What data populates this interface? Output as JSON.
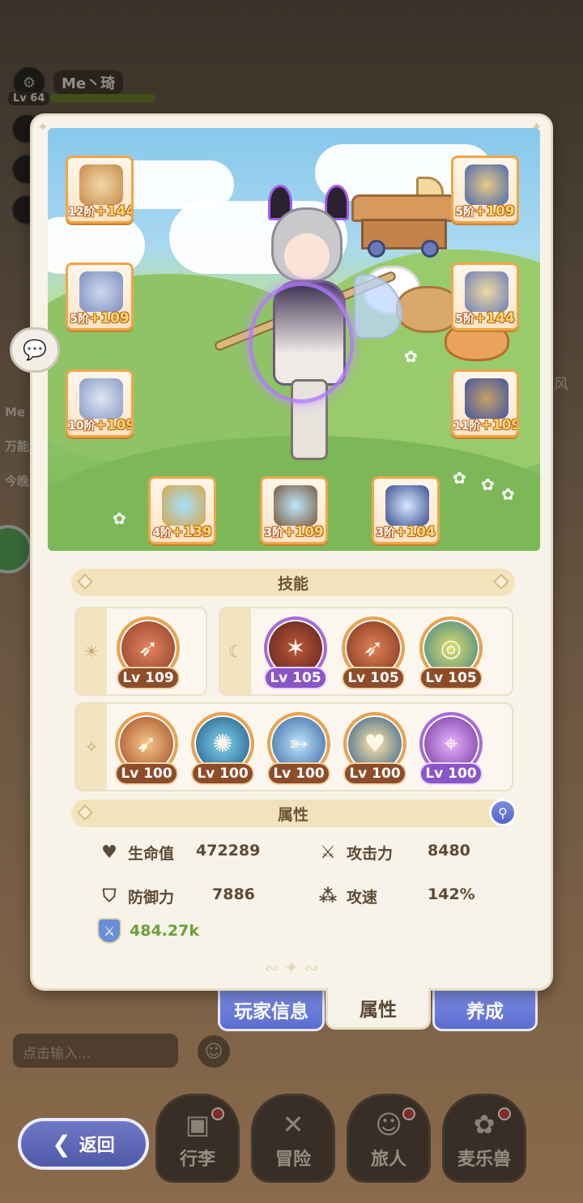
{
  "hud": {
    "player_name": "Me丶琦",
    "player_level": "Lv 64",
    "side_texts": [
      "Me",
      "万能",
      "今晚"
    ],
    "right_text": "风"
  },
  "chat": {
    "placeholder": "点击输入..."
  },
  "nav": {
    "items": [
      {
        "label": "行李",
        "icon": "luggage-icon",
        "badge": true
      },
      {
        "label": "冒险",
        "icon": "crossed-swords-icon",
        "badge": false
      },
      {
        "label": "旅人",
        "icon": "traveler-icon",
        "badge": true
      },
      {
        "label": "麦乐兽",
        "icon": "beast-icon",
        "badge": true
      }
    ],
    "back_label": "返回"
  },
  "equipment": {
    "left": [
      {
        "name": "bow",
        "tier": "12阶",
        "bonus": "+144"
      },
      {
        "name": "armor",
        "tier": "5阶",
        "bonus": "+109"
      },
      {
        "name": "greaves",
        "tier": "10阶",
        "bonus": "+109"
      }
    ],
    "right": [
      {
        "name": "helmet",
        "tier": "5阶",
        "bonus": "+109"
      },
      {
        "name": "gloves",
        "tier": "5阶",
        "bonus": "+144"
      },
      {
        "name": "boots",
        "tier": "11阶",
        "bonus": "+109"
      }
    ],
    "bottom": [
      {
        "name": "ring",
        "tier": "4阶",
        "bonus": "+139"
      },
      {
        "name": "necklace",
        "tier": "3阶",
        "bonus": "+109"
      },
      {
        "name": "amulet",
        "tier": "3阶",
        "bonus": "+104"
      }
    ]
  },
  "skills": {
    "header": "技能",
    "group1": {
      "icon": "sun-icon",
      "skills": [
        {
          "level": "Lv 109",
          "style": "orange"
        }
      ]
    },
    "group2": {
      "icon": "moon-icon",
      "skills": [
        {
          "level": "Lv 105",
          "style": "purple"
        },
        {
          "level": "Lv 105",
          "style": "orange"
        },
        {
          "level": "Lv 105",
          "style": "orange"
        }
      ]
    },
    "group3": {
      "icon": "star-icon",
      "skills": [
        {
          "level": "Lv 100",
          "style": "orange"
        },
        {
          "level": "Lv 100",
          "style": "orange"
        },
        {
          "level": "Lv 100",
          "style": "orange"
        },
        {
          "level": "Lv 100",
          "style": "orange"
        },
        {
          "level": "Lv 100",
          "style": "purple"
        }
      ]
    }
  },
  "attributes": {
    "header": "属性",
    "hp_label": "生命值",
    "hp_value": "472289",
    "atk_label": "攻击力",
    "atk_value": "8480",
    "def_label": "防御力",
    "def_value": "7886",
    "spd_label": "攻速",
    "spd_value": "142%",
    "power_value": "484.27k"
  },
  "tabs": {
    "player_info": "玩家信息",
    "attributes": "属性",
    "training": "养成"
  }
}
